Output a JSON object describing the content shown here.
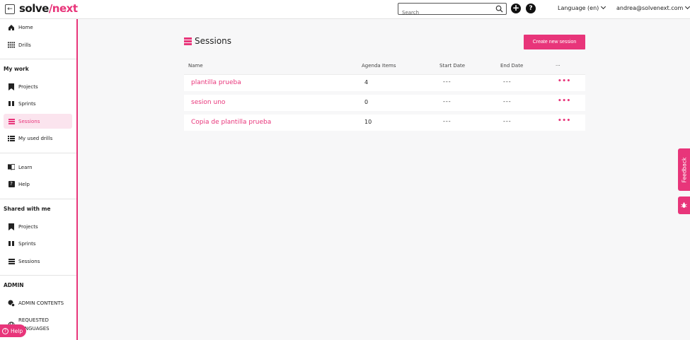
{
  "topbar": {
    "logo_main": "solve",
    "logo_accent": "/next",
    "search_placeholder": "Search",
    "language_label": "Language (en)",
    "user_email": "andrea@solvenext.com"
  },
  "sidebar": {
    "top_items": [
      {
        "label": "Home",
        "icon": "home-icon"
      },
      {
        "label": "Drills",
        "icon": "grid-icon"
      }
    ],
    "my_work_title": "My work",
    "my_work_items": [
      {
        "label": "Projects",
        "icon": "bookmark-icon"
      },
      {
        "label": "Sprints",
        "icon": "columns-icon"
      },
      {
        "label": "Sessions",
        "icon": "list-icon",
        "active": true
      },
      {
        "label": "My used drills",
        "icon": "list-detail-icon"
      }
    ],
    "learn_items": [
      {
        "label": "Learn",
        "icon": "book-icon"
      },
      {
        "label": "Help",
        "icon": "question-icon"
      }
    ],
    "shared_title": "Shared with me",
    "shared_items": [
      {
        "label": "Projects",
        "icon": "bookmark-icon"
      },
      {
        "label": "Sprints",
        "icon": "columns-icon"
      },
      {
        "label": "Sessions",
        "icon": "list-icon"
      }
    ],
    "admin_title": "ADMIN",
    "admin_items": [
      {
        "label": "ADMIN CONTENTS",
        "icon": "admin-gear-icon"
      },
      {
        "label_line1": "REQUESTED",
        "label_line2": "LANGUAGES",
        "icon": "globe-icon"
      }
    ],
    "help_pill": "Help"
  },
  "main": {
    "title": "Sessions",
    "create_button": "Create new session",
    "columns": [
      "Name",
      "Agenda Items",
      "Start Date",
      "End Date",
      "···"
    ],
    "rows": [
      {
        "name": "plantilla prueba",
        "agenda_items": "4",
        "start_date": "---",
        "end_date": "---",
        "menu": "•••"
      },
      {
        "name": "sesion uno",
        "agenda_items": "0",
        "start_date": "---",
        "end_date": "---",
        "menu": "•••"
      },
      {
        "name": "Copia de plantilla prueba",
        "agenda_items": "10",
        "start_date": "---",
        "end_date": "---",
        "menu": "•••"
      }
    ]
  },
  "side_tabs": {
    "feedback": "Feedback"
  },
  "colors": {
    "accent": "#e8357a",
    "active_bg": "#fbe4ee",
    "background": "#f7f7f8"
  }
}
